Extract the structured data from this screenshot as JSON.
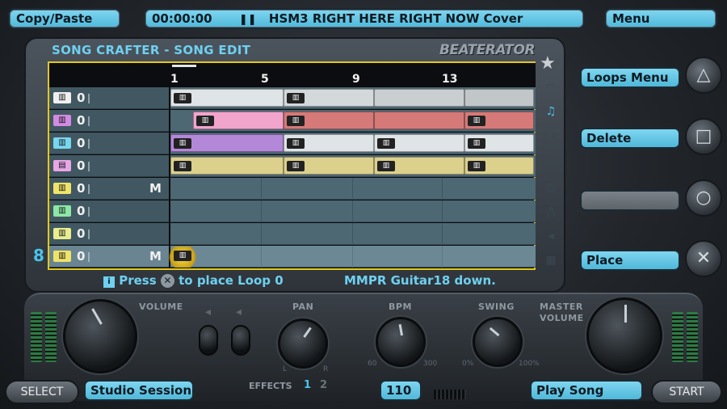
{
  "top_bar": {
    "left_label": "Copy/Paste",
    "time": "00:00:00",
    "song_title": "HSM3 RIGHT HERE RIGHT NOW Cover",
    "right_label": "Menu"
  },
  "panel": {
    "title": "SONG CRAFTER - SONG EDIT",
    "brand": "BEATERATOR"
  },
  "ruler": [
    "1",
    "5",
    "9",
    "13"
  ],
  "tracks": [
    {
      "num": "0",
      "mute": "",
      "icon_color": "#f0f0f0"
    },
    {
      "num": "0",
      "mute": "",
      "icon_color": "#d28be0"
    },
    {
      "num": "0",
      "mute": "",
      "icon_color": "#78d7ef"
    },
    {
      "num": "0",
      "mute": "",
      "icon_color": "#e7a6e6"
    },
    {
      "num": "0",
      "mute": "M",
      "icon_color": "#efe36a"
    },
    {
      "num": "0",
      "mute": "",
      "icon_color": "#8de7a6"
    },
    {
      "num": "0",
      "mute": "",
      "icon_color": "#e9ed8e"
    },
    {
      "num": "0",
      "mute": "M",
      "icon_color": "#efe36a"
    }
  ],
  "status": {
    "left_prefix": "Press",
    "left_suffix": "to place Loop 0",
    "right": "MMPR Guitar18 down."
  },
  "side_buttons": {
    "loops_menu": "Loops Menu",
    "delete": "Delete",
    "empty": "",
    "place": "Place"
  },
  "step_indicator": "8",
  "controls": {
    "volume": "VOLUME",
    "pan": "PAN",
    "bpm": "BPM",
    "swing": "SWING",
    "master_volume_1": "MASTER",
    "master_volume_2": "VOLUME",
    "effects": "EFFECTS",
    "effects_1": "1",
    "effects_2": "2",
    "bpm_min": "60",
    "bpm_max": "300",
    "swing_min": "0%",
    "swing_max": "100%",
    "pan_l": "L",
    "pan_r": "R"
  },
  "bottom": {
    "select": "SELECT",
    "studio": "Studio Session",
    "bpm_value": "110",
    "play": "Play Song",
    "start": "START"
  },
  "colors": {
    "accent": "#4fb8da",
    "grid_border": "#e3c81d",
    "loop_white": "#dfe4e6",
    "loop_pink": "#f1a4cc",
    "loop_red": "#d57a78",
    "loop_purple": "#b488d8",
    "loop_yellow": "#dcd08d"
  }
}
